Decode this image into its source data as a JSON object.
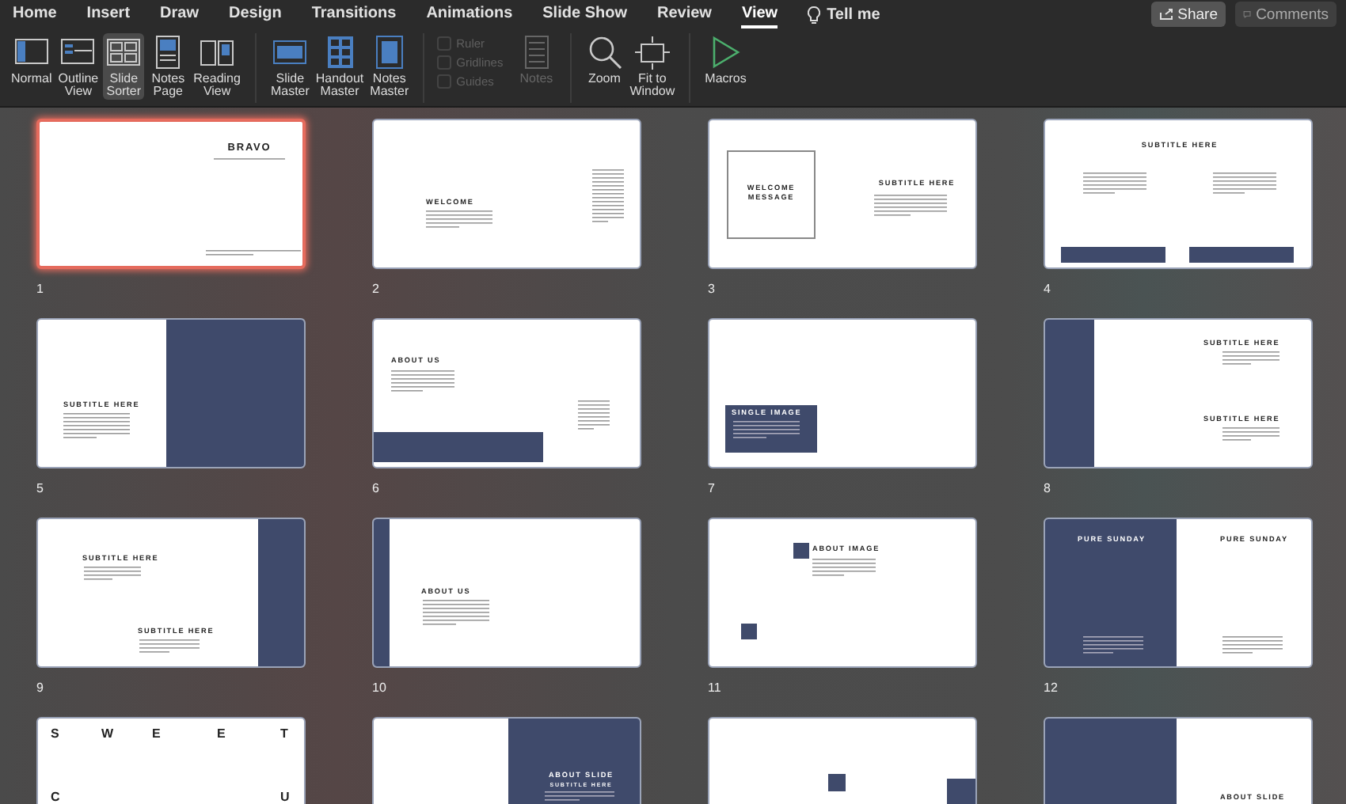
{
  "tabs": [
    {
      "label": "Home",
      "selected": false
    },
    {
      "label": "Insert",
      "selected": false
    },
    {
      "label": "Draw",
      "selected": false
    },
    {
      "label": "Design",
      "selected": false
    },
    {
      "label": "Transitions",
      "selected": false
    },
    {
      "label": "Animations",
      "selected": false
    },
    {
      "label": "Slide Show",
      "selected": false
    },
    {
      "label": "Review",
      "selected": false
    },
    {
      "label": "View",
      "selected": true
    }
  ],
  "tell_me": "Tell me",
  "share_button": "Share",
  "comments_button": {
    "label": "Comments",
    "disabled": true
  },
  "ribbon_groups": [
    {
      "items": [
        {
          "kind": "button",
          "label": "Normal",
          "selected": false,
          "disabled": false
        },
        {
          "kind": "button",
          "label": "Outline\nView",
          "selected": false,
          "disabled": false
        },
        {
          "kind": "button",
          "label": "Slide\nSorter",
          "selected": true,
          "disabled": false
        },
        {
          "kind": "button",
          "label": "Notes\nPage",
          "selected": false,
          "disabled": false
        },
        {
          "kind": "button",
          "label": "Reading\nView",
          "selected": false,
          "disabled": false
        }
      ]
    },
    {
      "items": [
        {
          "kind": "button",
          "label": "Slide\nMaster",
          "selected": false,
          "disabled": false
        },
        {
          "kind": "button",
          "label": "Handout\nMaster",
          "selected": false,
          "disabled": false
        },
        {
          "kind": "button",
          "label": "Notes\nMaster",
          "selected": false,
          "disabled": false
        }
      ]
    },
    {
      "items": [
        {
          "kind": "checkbox",
          "label": "Ruler",
          "checked": false,
          "disabled": true
        },
        {
          "kind": "checkbox",
          "label": "Gridlines",
          "checked": false,
          "disabled": true
        },
        {
          "kind": "checkbox",
          "label": "Guides",
          "checked": false,
          "disabled": true
        },
        {
          "kind": "button",
          "label": "Notes",
          "selected": false,
          "disabled": true
        }
      ]
    },
    {
      "items": [
        {
          "kind": "button",
          "label": "Zoom",
          "selected": false,
          "disabled": false
        },
        {
          "kind": "button",
          "label": "Fit to\nWindow",
          "selected": false,
          "disabled": false
        }
      ]
    },
    {
      "items": [
        {
          "kind": "button",
          "label": "Macros",
          "selected": false,
          "disabled": false
        }
      ]
    }
  ],
  "slides": [
    {
      "number": "1",
      "kind": "title",
      "selected": true,
      "texts": [
        "BRAVO"
      ]
    },
    {
      "number": "2",
      "kind": "welcome",
      "selected": false,
      "texts": [
        "WELCOME"
      ]
    },
    {
      "number": "3",
      "kind": "framed",
      "selected": false,
      "texts": [
        "WELCOME MESSAGE",
        "SUBTITLE HERE"
      ]
    },
    {
      "number": "4",
      "kind": "twocolumn",
      "selected": false,
      "texts": [
        "SUBTITLE HERE"
      ]
    },
    {
      "number": "5",
      "kind": "panelwide",
      "selected": false,
      "texts": [
        "SUBTITLE HERE"
      ]
    },
    {
      "number": "6",
      "kind": "aboutbar",
      "selected": false,
      "texts": [
        "ABOUT US"
      ]
    },
    {
      "number": "7",
      "kind": "caption",
      "selected": false,
      "texts": [
        "SINGLE IMAGE"
      ]
    },
    {
      "number": "8",
      "kind": "panelleft",
      "selected": false,
      "texts": [
        "SUBTITLE HERE",
        "SUBTITLE HERE"
      ]
    },
    {
      "number": "9",
      "kind": "panelnarrow",
      "selected": false,
      "texts": [
        "SUBTITLE HERE",
        "SUBTITLE HERE"
      ]
    },
    {
      "number": "10",
      "kind": "stripe",
      "selected": false,
      "texts": [
        "ABOUT US"
      ]
    },
    {
      "number": "11",
      "kind": "squares",
      "selected": false,
      "texts": [
        "ABOUT IMAGE"
      ]
    },
    {
      "number": "12",
      "kind": "split",
      "selected": false,
      "texts": [
        "PURE SUNDAY",
        "PURE SUNDAY"
      ]
    },
    {
      "kind": "letters",
      "selected": false,
      "texts": [
        "S",
        "W",
        "E",
        "E",
        "T",
        "C",
        "U"
      ]
    },
    {
      "kind": "panelhalf",
      "selected": false,
      "texts": [
        "ABOUT SLIDE",
        "SUBTITLE HERE"
      ]
    },
    {
      "kind": "squareslow",
      "selected": false
    },
    {
      "kind": "splitabout",
      "selected": false,
      "texts": [
        "ABOUT SLIDE"
      ]
    }
  ]
}
